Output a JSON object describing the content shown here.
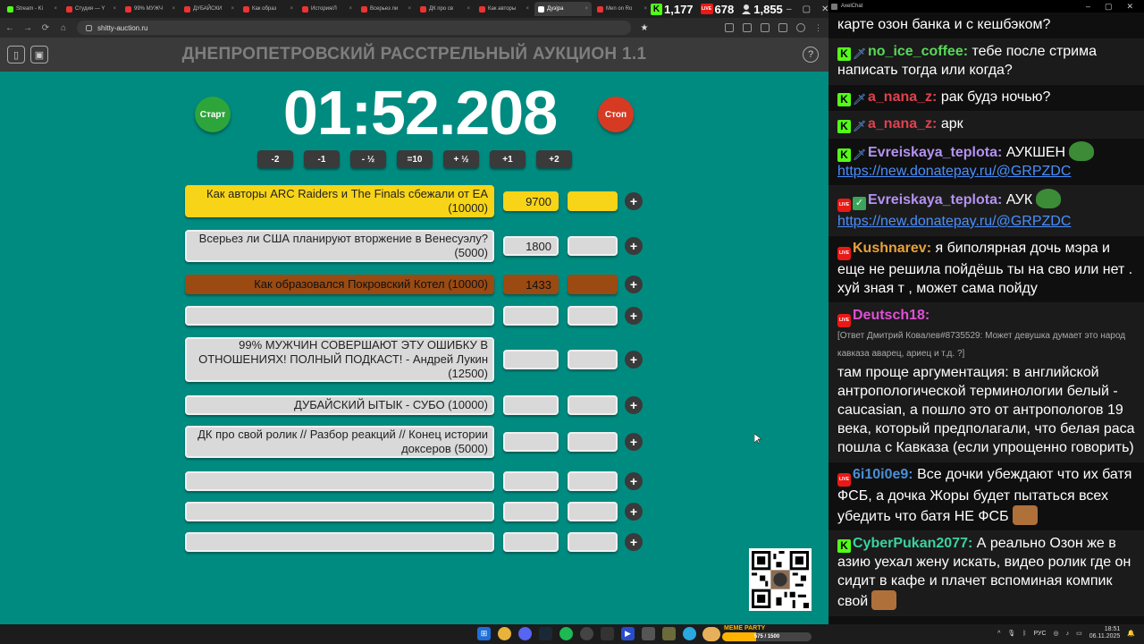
{
  "browser": {
    "tabs": [
      {
        "label": "Stream - Ki",
        "type": "kick"
      },
      {
        "label": "Студия — Y",
        "type": "yt"
      },
      {
        "label": "99% МУЖЧ",
        "type": "yt"
      },
      {
        "label": "ДУБАЙСКИ",
        "type": "yt"
      },
      {
        "label": "Как образ",
        "type": "yt"
      },
      {
        "label": "История/Л",
        "type": "yt"
      },
      {
        "label": "Всерьез ли",
        "type": "yt"
      },
      {
        "label": "ДК про св",
        "type": "yt"
      },
      {
        "label": "Как авторы",
        "type": "yt"
      },
      {
        "label": "Дуэ|ра",
        "type": "active"
      },
      {
        "label": "Men on Ro",
        "type": "yt"
      }
    ],
    "url": "shitty-auction.ru",
    "stats": {
      "kick_viewers": "1,177",
      "live_viewers": "678",
      "total_viewers": "1,855"
    }
  },
  "app": {
    "title": "ДНЕПРОПЕТРОВСКИЙ РАССТРЕЛЬНЫЙ АУКЦИОН 1.1",
    "timer": "01:52.208",
    "start_label": "Старт",
    "stop_label": "Стоп",
    "adjust_buttons": [
      "-2",
      "-1",
      "- ½",
      "=10",
      "+ ½",
      "+1",
      "+2"
    ],
    "lots": [
      {
        "name": "Как авторы ARC Raiders и The Finals сбежали от EA (10000)",
        "value": "9700",
        "style": "gold"
      },
      {
        "name": "Всерьез ли США планируют вторжение в Венесуэлу? (5000)",
        "value": "1800",
        "style": "gray"
      },
      {
        "name": "Как образовался Покровский Котел (10000)",
        "value": "1433",
        "style": "brown"
      },
      {
        "name": "",
        "value": "",
        "style": "gray"
      },
      {
        "name": "99% МУЖЧИН СОВЕРШАЮТ ЭТУ ОШИБКУ В ОТНОШЕНИЯХ! ПОЛНЫЙ ПОДКАСТ! - Андрей Лукин (12500)",
        "value": "",
        "style": "gray"
      },
      {
        "name": "ДУБАЙСКИЙ ЫТЫК - СУБО (10000)",
        "value": "",
        "style": "gray"
      },
      {
        "name": "ДК про свой ролик // Разбор реакций // Конец истории доксеров (5000)",
        "value": "",
        "style": "gray"
      },
      {
        "name": "",
        "value": "",
        "style": "gray"
      },
      {
        "name": "",
        "value": "",
        "style": "gray"
      },
      {
        "name": "",
        "value": "",
        "style": "gray"
      }
    ]
  },
  "chat": {
    "window_title": "AxelChat",
    "messages": [
      {
        "badges": [],
        "user": "",
        "color": "#ffffff",
        "text": "карте озон банка и с кешбэком?"
      },
      {
        "badges": [
          "kick",
          "sword"
        ],
        "user": "no_ice_coffee",
        "color": "#58d858",
        "text": "тебе после стрима написать тогда или когда?"
      },
      {
        "badges": [
          "kick",
          "sword"
        ],
        "user": "a_nana_z",
        "color": "#e0414e",
        "text": "рак будэ ночью?"
      },
      {
        "badges": [
          "kick",
          "sword"
        ],
        "user": "a_nana_z",
        "color": "#e0414e",
        "text": "арк"
      },
      {
        "badges": [
          "kick",
          "sword"
        ],
        "user": "Evreiskaya_teplota",
        "color": "#b392f0",
        "text": "АУКШЕН",
        "emote": "frog",
        "link": "https://new.donatepay.ru/@GRPZDC"
      },
      {
        "badges": [
          "live",
          "check"
        ],
        "user": "Evreiskaya_teplota",
        "color": "#b392f0",
        "text": "АУК",
        "emote": "frog",
        "link": "https://new.donatepay.ru/@GRPZDC"
      },
      {
        "badges": [
          "live"
        ],
        "user": "Kushnarev",
        "color": "#e8a23b",
        "text": "я биполярная дочь мэра и еще не решила пойдёшь ты на сво или нет . хуй зная т , может сама пойду"
      },
      {
        "badges": [
          "live"
        ],
        "user": "Deutsch18",
        "color": "#e04fd6",
        "text": "там проще аргументация: в английской антропологической терминологии белый - caucasian, а пошло это от антропологов 19 века, который предполагали, что белая раса пошла с Кавказа (если упрощенно говорить)",
        "reply": "[Ответ Дмитрий Ковалев#8735529: Может девушка думает это народ кавказа аварец, ариец и т.д. ?]"
      },
      {
        "badges": [
          "live"
        ],
        "user": "6i10i0e9",
        "color": "#4a8fd6",
        "text": "Все дочки убеждают что их батя ФСБ, а дочка Жоры будет пытаться всех убедить что батя НЕ ФСБ",
        "emote": "face"
      },
      {
        "badges": [
          "kick"
        ],
        "user": "CyberPukan2077",
        "color": "#3bd1a0",
        "text": "А реально Озон же в азию уехал жену искать, видео ролик где он сидит в кафе и плачет вспоминая компик свой",
        "emote": "face"
      }
    ]
  },
  "taskbar": {
    "meme_label": "MEME PARTY",
    "meme_progress": "575 / 1500",
    "meme_fraction": 0.383,
    "lang": "РУС",
    "time": "18:51",
    "date": "06.11.2025"
  },
  "colors": {
    "app_bg": "#008b80",
    "gold": "#f7d417",
    "brown": "#9b4a12",
    "start": "#2ea53a",
    "stop": "#d73a22"
  }
}
